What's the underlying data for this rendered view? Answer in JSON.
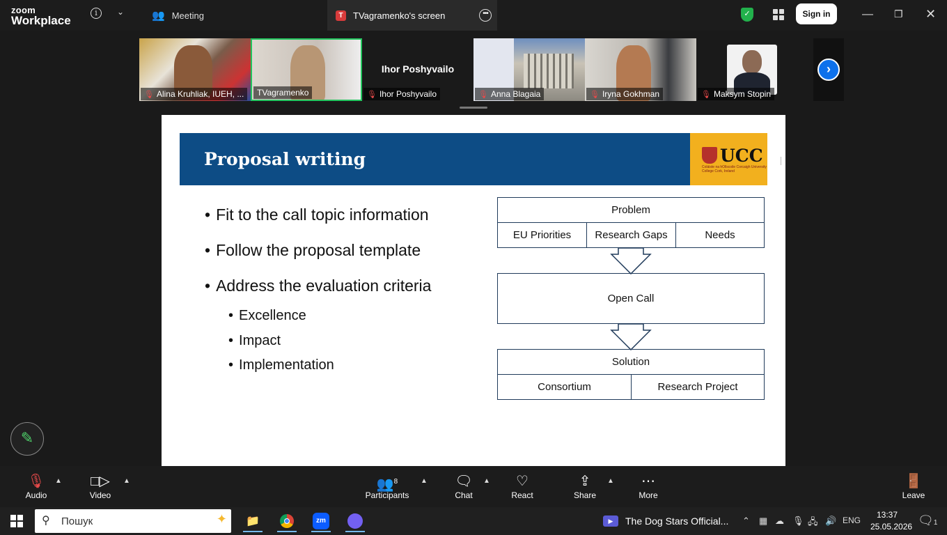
{
  "app": {
    "logo_line1": "zoom",
    "logo_line2": "Workplace"
  },
  "tabs": {
    "meeting": "Meeting",
    "screen": "TVagramenko's screen",
    "screen_badge": "T"
  },
  "header": {
    "sign_in": "Sign in"
  },
  "participants": [
    {
      "name": "Alina Kruhliak, IUEH, ...",
      "muted": true
    },
    {
      "name": "TVagramenko",
      "muted": false
    },
    {
      "name": "Ihor Poshyvailo",
      "muted": true,
      "title": "Ihor Poshyvailo"
    },
    {
      "name": "Anna Blagaia",
      "muted": true
    },
    {
      "name": "Iryna Gokhman",
      "muted": true
    },
    {
      "name": "Maksym Stopin",
      "muted": true
    }
  ],
  "slide": {
    "title": "Proposal writing",
    "logo_text": "UCC",
    "logo_sub": "Coláiste na hOllscoile Corcaigh University College Cork, Ireland",
    "bullets": [
      "Fit to the call topic information",
      "Follow the proposal template",
      "Address the evaluation criteria"
    ],
    "sub_bullets": [
      "Excellence",
      "Impact",
      "Implementation"
    ],
    "diagram": {
      "problem": "Problem",
      "problem_items": [
        "EU Priorities",
        "Research Gaps",
        "Needs"
      ],
      "open_call": "Open Call",
      "solution": "Solution",
      "solution_items": [
        "Consortium",
        "Research Project"
      ]
    }
  },
  "toolbar": {
    "audio": "Audio",
    "video": "Video",
    "participants": "Participants",
    "participants_count": "8",
    "chat": "Chat",
    "react": "React",
    "share": "Share",
    "more": "More",
    "leave": "Leave"
  },
  "taskbar": {
    "search_placeholder": "Пошук",
    "media_title": "The Dog Stars Official...",
    "language": "ENG",
    "time": "13:37",
    "date": "25.05.2026",
    "notifications": "1"
  },
  "colors": {
    "banner": "#0d4c85",
    "ucc_gold": "#f2b01e",
    "accent_blue": "#0e71eb",
    "speaker_green": "#22c55e"
  }
}
